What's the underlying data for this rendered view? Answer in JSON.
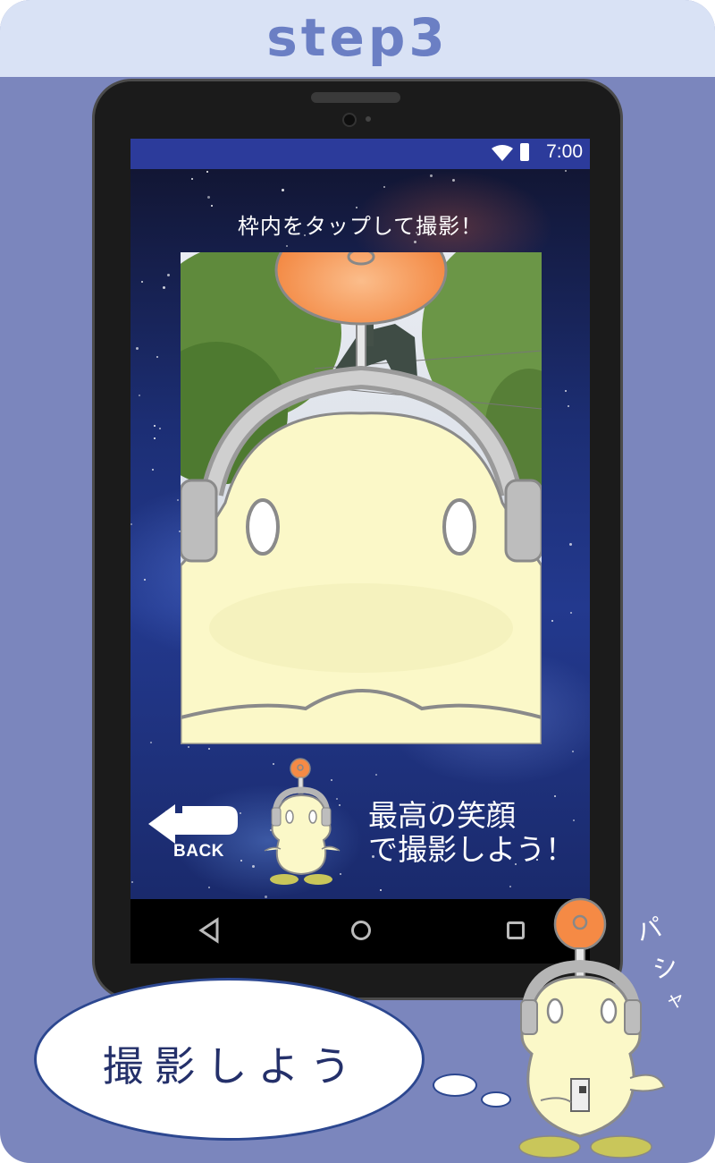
{
  "header": {
    "title": "step3"
  },
  "status_bar": {
    "time": "7:00",
    "wifi_icon": "wifi-icon",
    "battery_icon": "battery-icon"
  },
  "screen": {
    "instruction": "枠内をタップして撮影！",
    "back_button": {
      "label": "BACK",
      "icon": "back-arrow-icon"
    },
    "message_line1": "最高の笑顔",
    "message_line2": "で撮影しよう！"
  },
  "nav_bar": {
    "back_icon": "triangle-back-icon",
    "home_icon": "circle-home-icon",
    "recents_icon": "square-recents-icon"
  },
  "speech_bubble": {
    "text": "撮影しよう"
  },
  "sound_effect": {
    "chars": [
      "パ",
      "シ",
      "ャ"
    ]
  },
  "colors": {
    "card_background": "#7b86bd",
    "header_background": "#d9e2f5",
    "title_color": "#6b7fc4",
    "status_bar": "#2c3b9b",
    "mascot_body": "#fbf8c8",
    "mascot_antenna": "#f58a45",
    "bubble_border": "#2c4790"
  }
}
